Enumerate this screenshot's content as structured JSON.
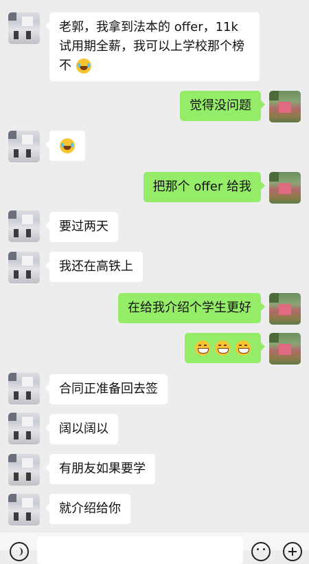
{
  "messages": [
    {
      "side": "in",
      "text": "老郭，我拿到法本的 offer，11k 试用期全薪，我可以上学校那个榜不",
      "emoji": "laughing-with-tears"
    },
    {
      "side": "out",
      "text": "觉得没问题"
    },
    {
      "side": "in",
      "emoji": "laughing-with-tears"
    },
    {
      "side": "out",
      "text": "把那个 offer 给我"
    },
    {
      "side": "in",
      "text": "要过两天"
    },
    {
      "side": "in",
      "text": "我还在高铁上"
    },
    {
      "side": "out",
      "text": "在给我介绍个学生更好"
    },
    {
      "side": "out",
      "emoji": "grinning-face",
      "count": 3
    },
    {
      "side": "in",
      "text": "合同正准备回去签"
    },
    {
      "side": "in",
      "text": "阔以阔以"
    },
    {
      "side": "in",
      "text": "有朋友如果要学"
    },
    {
      "side": "in",
      "text": "就介绍给你"
    }
  ],
  "input_bar": {
    "voice_icon": "voice-icon",
    "emoji_icon": "emoji-icon",
    "plus_icon": "plus-icon"
  },
  "colors": {
    "background": "#ededed",
    "incoming_bubble": "#ffffff",
    "outgoing_bubble": "#95ec69"
  }
}
